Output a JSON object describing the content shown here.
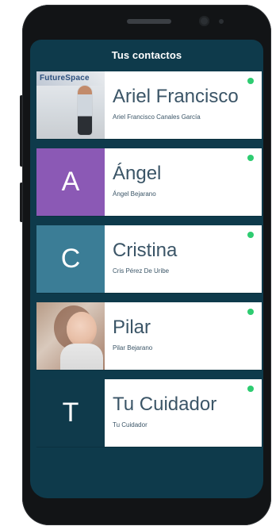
{
  "app": {
    "header_title": "Tus contactos"
  },
  "contacts": [
    {
      "avatar_type": "photo",
      "avatar_overlay_text": "FutureSpace",
      "name": "Ariel Francisco",
      "full_name": "Ariel Francisco Canales García",
      "status_color": "#2ecc71"
    },
    {
      "avatar_type": "letter",
      "letter": "A",
      "avatar_color": "#8b59b5",
      "name": "Ángel",
      "full_name": "Ángel Bejarano",
      "status_color": "#2ecc71"
    },
    {
      "avatar_type": "letter",
      "letter": "C",
      "avatar_color": "#3b7d96",
      "name": "Cristina",
      "full_name": "Cris Pérez De Uribe",
      "status_color": "#2ecc71"
    },
    {
      "avatar_type": "photo",
      "name": "Pilar",
      "full_name": "Pilar Bejarano",
      "status_color": "#2ecc71"
    },
    {
      "avatar_type": "letter",
      "letter": "T",
      "avatar_color": "#0f3a4b",
      "name": "Tu Cuidador",
      "full_name": "Tu Cuidador",
      "status_color": "#2ecc71"
    }
  ],
  "colors": {
    "screen_background": "#0e3a4b",
    "card_background": "#ffffff",
    "name_text": "#3b5567",
    "online_dot": "#2ecc71"
  }
}
